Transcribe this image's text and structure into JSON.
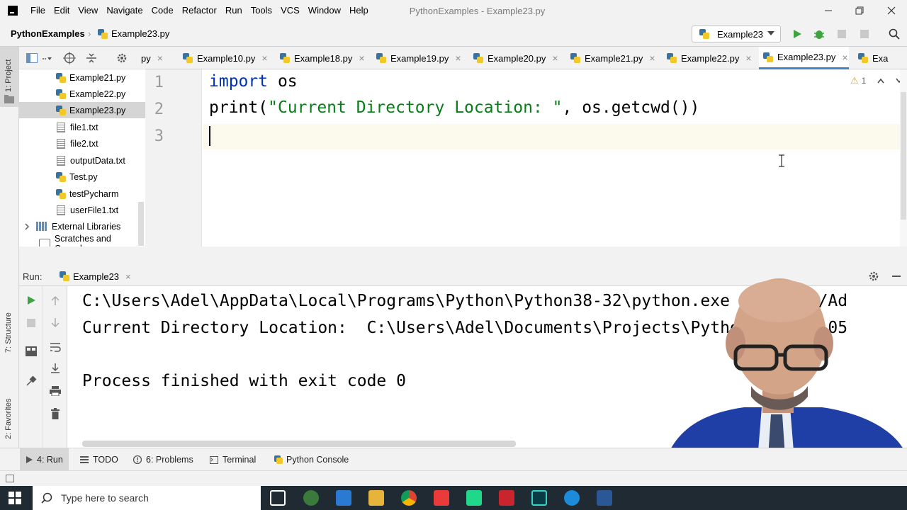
{
  "menubar": {
    "items": [
      "File",
      "Edit",
      "View",
      "Navigate",
      "Code",
      "Refactor",
      "Run",
      "Tools",
      "VCS",
      "Window",
      "Help"
    ],
    "window_title": "PythonExamples - Example23.py"
  },
  "navbar": {
    "project": "PythonExamples",
    "file": "Example23.py",
    "run_config": "Example23"
  },
  "left_strip": {
    "project_tab": "1: Project",
    "structure_tab": "7: Structure",
    "favorites_tab": "2: Favorites"
  },
  "project_tree": {
    "items": [
      {
        "label": "Example21.py",
        "type": "py"
      },
      {
        "label": "Example22.py",
        "type": "py"
      },
      {
        "label": "Example23.py",
        "type": "py",
        "selected": true
      },
      {
        "label": "file1.txt",
        "type": "txt"
      },
      {
        "label": "file2.txt",
        "type": "txt"
      },
      {
        "label": "outputData.txt",
        "type": "txt"
      },
      {
        "label": "Test.py",
        "type": "py"
      },
      {
        "label": "testPycharm",
        "type": "py"
      },
      {
        "label": "userFile1.txt",
        "type": "txt"
      }
    ],
    "external_libraries": "External Libraries",
    "scratches": "Scratches and Console"
  },
  "editor_tabs": {
    "partial_left": "py",
    "tabs": [
      "Example10.py",
      "Example18.py",
      "Example19.py",
      "Example20.py",
      "Example21.py",
      "Example22.py",
      "Example23.py"
    ],
    "partial_right": "Exa",
    "active": "Example23.py"
  },
  "editor": {
    "line_numbers": [
      "1",
      "2",
      "3"
    ],
    "line1_kw": "import",
    "line1_rest": " os",
    "line2_fn": "print(",
    "line2_str": "\"Current Directory Location: \"",
    "line2_rest": ", os.getcwd())",
    "warnings": "1"
  },
  "run_panel": {
    "label": "Run:",
    "tab": "Example23",
    "output": [
      "C:\\Users\\Adel\\AppData\\Local\\Programs\\Python\\Python38-32\\python.exe C:/Users/Ad",
      "Current Directory Location:  C:\\Users\\Adel\\Documents\\Projects\\Python\\python105",
      "",
      "Process finished with exit code 0"
    ]
  },
  "bottom_tabs": {
    "run": "4: Run",
    "todo": "TODO",
    "problems": "6: Problems",
    "terminal": "Terminal",
    "python_console": "Python Console"
  },
  "taskbar": {
    "search_placeholder": "Type here to search"
  },
  "colors": {
    "keyword": "#0033b3",
    "string": "#067d17",
    "run_green": "#3fa33f",
    "active_tab_underline": "#4083c9"
  }
}
